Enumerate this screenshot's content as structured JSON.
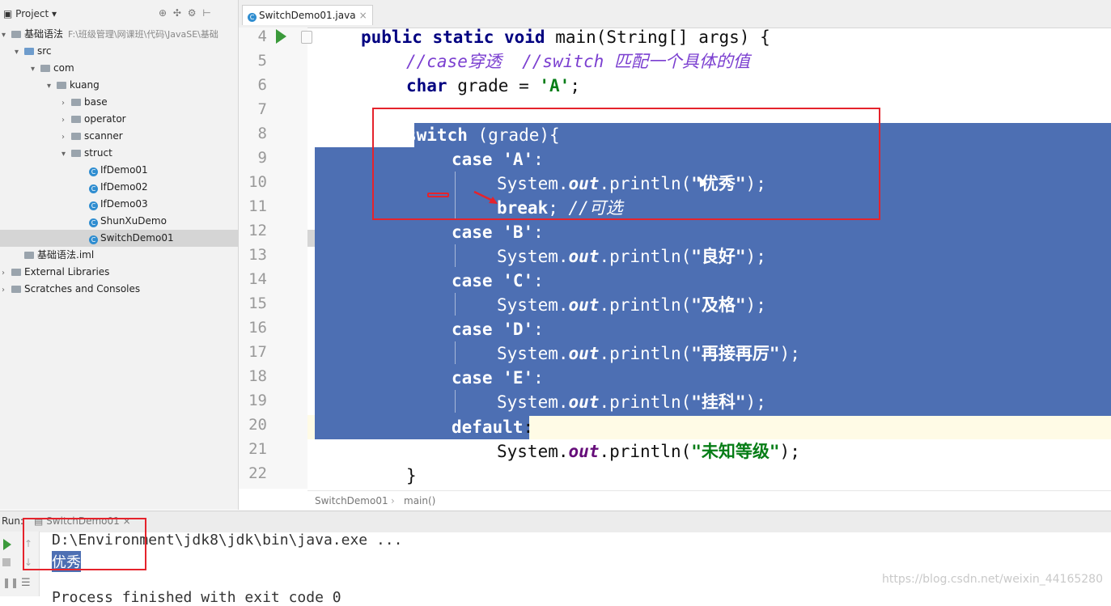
{
  "project": {
    "header": "Project",
    "tree": [
      {
        "label": "基础语法",
        "hint": "F:\\班级管理\\网课班\\代码\\JavaSE\\基础",
        "indent": 0,
        "arrow": "▾",
        "icon": "folder"
      },
      {
        "label": "src",
        "indent": 1,
        "arrow": "▾",
        "icon": "folder-blue"
      },
      {
        "label": "com",
        "indent": 2,
        "arrow": "▾",
        "icon": "folder"
      },
      {
        "label": "kuang",
        "indent": 3,
        "arrow": "▾",
        "icon": "folder"
      },
      {
        "label": "base",
        "indent": 4,
        "arrow": "›",
        "icon": "folder"
      },
      {
        "label": "operator",
        "indent": 4,
        "arrow": "›",
        "icon": "folder"
      },
      {
        "label": "scanner",
        "indent": 4,
        "arrow": "›",
        "icon": "folder"
      },
      {
        "label": "struct",
        "indent": 4,
        "arrow": "▾",
        "icon": "folder"
      },
      {
        "label": "IfDemo01",
        "indent": 5,
        "arrow": "",
        "icon": "java"
      },
      {
        "label": "IfDemo02",
        "indent": 5,
        "arrow": "",
        "icon": "java"
      },
      {
        "label": "IfDemo03",
        "indent": 5,
        "arrow": "",
        "icon": "java"
      },
      {
        "label": "ShunXuDemo",
        "indent": 5,
        "arrow": "",
        "icon": "java"
      },
      {
        "label": "SwitchDemo01",
        "indent": 5,
        "arrow": "",
        "icon": "java",
        "selected": true
      },
      {
        "label": "基础语法.iml",
        "indent": 1,
        "arrow": "",
        "icon": "file"
      },
      {
        "label": "External Libraries",
        "indent": 0,
        "arrow": "›",
        "icon": "lib"
      },
      {
        "label": "Scratches and Consoles",
        "indent": 0,
        "arrow": "›",
        "icon": "scratch"
      }
    ]
  },
  "tab": {
    "title": "SwitchDemo01.java",
    "close": "×"
  },
  "editor": {
    "line_numbers": [
      "4",
      "5",
      "6",
      "7",
      "8",
      "9",
      "10",
      "11",
      "12",
      "13",
      "14",
      "15",
      "16",
      "17",
      "18",
      "19",
      "20",
      "21",
      "22"
    ],
    "lines": {
      "l4a": "public static void ",
      "l4b": "main(String[] args) {",
      "l5": "//case穿透  //switch 匹配一个具体的值",
      "l6a": "char ",
      "l6b": "grade = ",
      "l6c": "'A'",
      "l6d": ";",
      "l8a": "switch",
      "l8b": " (grade){",
      "l9a": "case ",
      "l9b": "'A'",
      "l9c": ":",
      "l10a": "System.",
      "l10b": "out",
      "l10c": ".println(",
      "l10d": "\"优秀\"",
      "l10e": ");",
      "l11a": "break",
      "l11b": "; ",
      "l11c": "//可选",
      "l12a": "case ",
      "l12b": "'B'",
      "l12c": ":",
      "l13a": "System.",
      "l13b": "out",
      "l13c": ".println(",
      "l13d": "\"良好\"",
      "l13e": ");",
      "l14a": "case ",
      "l14b": "'C'",
      "l14c": ":",
      "l15a": "System.",
      "l15b": "out",
      "l15c": ".println(",
      "l15d": "\"及格\"",
      "l15e": ");",
      "l16a": "case ",
      "l16b": "'D'",
      "l16c": ":",
      "l17a": "System.",
      "l17b": "out",
      "l17c": ".println(",
      "l17d": "\"再接再厉\"",
      "l17e": ");",
      "l18a": "case ",
      "l18b": "'E'",
      "l18c": ":",
      "l19a": "System.",
      "l19b": "out",
      "l19c": ".println(",
      "l19d": "\"挂科\"",
      "l19e": ");",
      "l20a": "default",
      "l20b": ":",
      "l21a": "System.",
      "l21b": "out",
      "l21c": ".println(",
      "l21d": "\"未知等级\"",
      "l21e": ");",
      "l22": "}"
    },
    "breadcrumb": [
      "SwitchDemo01",
      "main()"
    ]
  },
  "run": {
    "label": "Run:",
    "config_tab": "SwitchDemo01",
    "console": [
      "D:\\Environment\\jdk8\\jdk\\bin\\java.exe ...",
      "优秀",
      "Process finished with exit code 0"
    ]
  },
  "watermark": "https://blog.csdn.net/weixin_44165280",
  "colors": {
    "selection": "#4d6fb3",
    "annotation": "#e5232c",
    "keyword": "#000080",
    "string": "#067d17"
  }
}
